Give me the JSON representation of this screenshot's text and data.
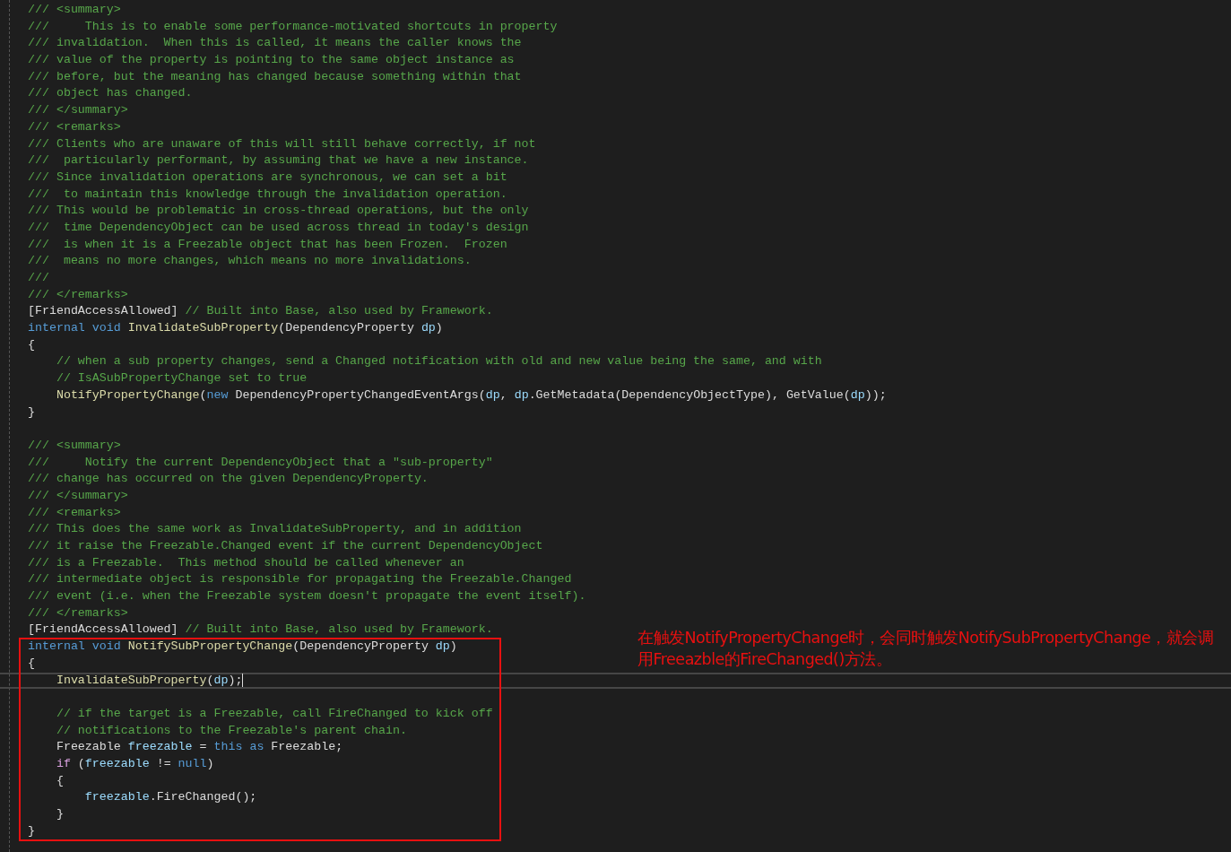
{
  "editor": {
    "blocks": [
      {
        "boxed": false,
        "lines": [
          {
            "kind": "code",
            "current": false,
            "tokens": [
              {
                "kind": "comment",
                "text": "/// <summary>"
              }
            ]
          },
          {
            "kind": "code",
            "current": false,
            "tokens": [
              {
                "kind": "comment",
                "text": "///     This is to enable some performance-motivated shortcuts in property"
              }
            ]
          },
          {
            "kind": "code",
            "current": false,
            "tokens": [
              {
                "kind": "comment",
                "text": "/// invalidation.  When this is called, it means the caller knows the"
              }
            ]
          },
          {
            "kind": "code",
            "current": false,
            "tokens": [
              {
                "kind": "comment",
                "text": "/// value of the property is pointing to the same object instance as"
              }
            ]
          },
          {
            "kind": "code",
            "current": false,
            "tokens": [
              {
                "kind": "comment",
                "text": "/// before, but the meaning has changed because something within that"
              }
            ]
          },
          {
            "kind": "code",
            "current": false,
            "tokens": [
              {
                "kind": "comment",
                "text": "/// object has changed."
              }
            ]
          },
          {
            "kind": "code",
            "current": false,
            "tokens": [
              {
                "kind": "comment",
                "text": "/// </summary>"
              }
            ]
          },
          {
            "kind": "code",
            "current": false,
            "tokens": [
              {
                "kind": "comment",
                "text": "/// <remarks>"
              }
            ]
          },
          {
            "kind": "code",
            "current": false,
            "tokens": [
              {
                "kind": "comment",
                "text": "/// Clients who are unaware of this will still behave correctly, if not"
              }
            ]
          },
          {
            "kind": "code",
            "current": false,
            "tokens": [
              {
                "kind": "comment",
                "text": "///  particularly performant, by assuming that we have a new instance."
              }
            ]
          },
          {
            "kind": "code",
            "current": false,
            "tokens": [
              {
                "kind": "comment",
                "text": "/// Since invalidation operations are synchronous, we can set a bit"
              }
            ]
          },
          {
            "kind": "code",
            "current": false,
            "tokens": [
              {
                "kind": "comment",
                "text": "///  to maintain this knowledge through the invalidation operation."
              }
            ]
          },
          {
            "kind": "code",
            "current": false,
            "tokens": [
              {
                "kind": "comment",
                "text": "/// This would be problematic in cross-thread operations, but the only"
              }
            ]
          },
          {
            "kind": "code",
            "current": false,
            "tokens": [
              {
                "kind": "comment",
                "text": "///  time DependencyObject can be used across thread in today's design"
              }
            ]
          },
          {
            "kind": "code",
            "current": false,
            "tokens": [
              {
                "kind": "comment",
                "text": "///  is when it is a Freezable object that has been Frozen.  Frozen"
              }
            ]
          },
          {
            "kind": "code",
            "current": false,
            "tokens": [
              {
                "kind": "comment",
                "text": "///  means no more changes, which means no more invalidations."
              }
            ]
          },
          {
            "kind": "code",
            "current": false,
            "tokens": [
              {
                "kind": "comment",
                "text": "///"
              }
            ]
          },
          {
            "kind": "code",
            "current": false,
            "tokens": [
              {
                "kind": "comment",
                "text": "/// </remarks>"
              }
            ]
          },
          {
            "kind": "code",
            "current": false,
            "tokens": [
              {
                "kind": "plain",
                "text": "[FriendAccessAllowed] "
              },
              {
                "kind": "comment",
                "text": "// Built into Base, also used by Framework."
              }
            ]
          },
          {
            "kind": "code",
            "current": false,
            "tokens": [
              {
                "kind": "keyword",
                "text": "internal void "
              },
              {
                "kind": "method",
                "text": "InvalidateSubProperty"
              },
              {
                "kind": "plain",
                "text": "(DependencyProperty "
              },
              {
                "kind": "variable",
                "text": "dp"
              },
              {
                "kind": "plain",
                "text": ")"
              }
            ]
          },
          {
            "kind": "code",
            "current": false,
            "tokens": [
              {
                "kind": "plain",
                "text": "{"
              }
            ]
          },
          {
            "kind": "code",
            "current": false,
            "tokens": [
              {
                "kind": "comment",
                "text": "    // when a sub property changes, send a Changed notification with old and new value being the same, and with"
              }
            ]
          },
          {
            "kind": "code",
            "current": false,
            "tokens": [
              {
                "kind": "comment",
                "text": "    // IsASubPropertyChange set to true"
              }
            ]
          },
          {
            "kind": "code",
            "current": false,
            "tokens": [
              {
                "kind": "method",
                "text": "    NotifyPropertyChange"
              },
              {
                "kind": "plain",
                "text": "("
              },
              {
                "kind": "keyword",
                "text": "new"
              },
              {
                "kind": "plain",
                "text": " DependencyPropertyChangedEventArgs("
              },
              {
                "kind": "variable",
                "text": "dp"
              },
              {
                "kind": "plain",
                "text": ", "
              },
              {
                "kind": "variable",
                "text": "dp"
              },
              {
                "kind": "plain",
                "text": ".GetMetadata(DependencyObjectType), GetValue("
              },
              {
                "kind": "variable",
                "text": "dp"
              },
              {
                "kind": "plain",
                "text": "));"
              }
            ]
          },
          {
            "kind": "code",
            "current": false,
            "tokens": [
              {
                "kind": "plain",
                "text": "}"
              }
            ]
          },
          {
            "kind": "blank",
            "current": false
          },
          {
            "kind": "code",
            "current": false,
            "tokens": [
              {
                "kind": "comment",
                "text": "/// <summary>"
              }
            ]
          },
          {
            "kind": "code",
            "current": false,
            "tokens": [
              {
                "kind": "comment",
                "text": "///     Notify the current DependencyObject that a \"sub-property\""
              }
            ]
          },
          {
            "kind": "code",
            "current": false,
            "tokens": [
              {
                "kind": "comment",
                "text": "/// change has occurred on the given DependencyProperty."
              }
            ]
          },
          {
            "kind": "code",
            "current": false,
            "tokens": [
              {
                "kind": "comment",
                "text": "/// </summary>"
              }
            ]
          },
          {
            "kind": "code",
            "current": false,
            "tokens": [
              {
                "kind": "comment",
                "text": "/// <remarks>"
              }
            ]
          },
          {
            "kind": "code",
            "current": false,
            "tokens": [
              {
                "kind": "comment",
                "text": "/// This does the same work as InvalidateSubProperty, and in addition"
              }
            ]
          },
          {
            "kind": "code",
            "current": false,
            "tokens": [
              {
                "kind": "comment",
                "text": "/// it raise the Freezable.Changed event if the current DependencyObject"
              }
            ]
          },
          {
            "kind": "code",
            "current": false,
            "tokens": [
              {
                "kind": "comment",
                "text": "/// is a Freezable.  This method should be called whenever an"
              }
            ]
          },
          {
            "kind": "code",
            "current": false,
            "tokens": [
              {
                "kind": "comment",
                "text": "/// intermediate object is responsible for propagating the Freezable.Changed"
              }
            ]
          },
          {
            "kind": "code",
            "current": false,
            "tokens": [
              {
                "kind": "comment",
                "text": "/// event (i.e. when the Freezable system doesn't propagate the event itself)."
              }
            ]
          },
          {
            "kind": "code",
            "current": false,
            "tokens": [
              {
                "kind": "comment",
                "text": "/// </remarks>"
              }
            ]
          },
          {
            "kind": "code",
            "current": false,
            "tokens": [
              {
                "kind": "plain",
                "text": "[FriendAccessAllowed] "
              },
              {
                "kind": "comment",
                "text": "// Built into Base, also used by Framework."
              }
            ]
          }
        ]
      },
      {
        "boxed": true,
        "lines": [
          {
            "kind": "code",
            "current": false,
            "tokens": [
              {
                "kind": "keyword",
                "text": "internal void "
              },
              {
                "kind": "method",
                "text": "NotifySubPropertyChange"
              },
              {
                "kind": "plain",
                "text": "(DependencyProperty "
              },
              {
                "kind": "variable",
                "text": "dp"
              },
              {
                "kind": "plain",
                "text": ")"
              }
            ]
          },
          {
            "kind": "code",
            "current": false,
            "tokens": [
              {
                "kind": "plain",
                "text": "{"
              }
            ]
          },
          {
            "kind": "code",
            "current": true,
            "tokens": [
              {
                "kind": "method",
                "text": "    InvalidateSubProperty"
              },
              {
                "kind": "plain",
                "text": "("
              },
              {
                "kind": "variable",
                "text": "dp"
              },
              {
                "kind": "plain",
                "text": ");"
              }
            ]
          },
          {
            "kind": "blank",
            "current": false
          },
          {
            "kind": "code",
            "current": false,
            "tokens": [
              {
                "kind": "comment",
                "text": "    // if the target is a Freezable, call FireChanged to kick off"
              }
            ]
          },
          {
            "kind": "code",
            "current": false,
            "tokens": [
              {
                "kind": "comment",
                "text": "    // notifications to the Freezable's parent chain."
              }
            ]
          },
          {
            "kind": "code",
            "current": false,
            "tokens": [
              {
                "kind": "plain",
                "text": "    Freezable "
              },
              {
                "kind": "variable",
                "text": "freezable"
              },
              {
                "kind": "plain",
                "text": " = "
              },
              {
                "kind": "keyword",
                "text": "this as"
              },
              {
                "kind": "plain",
                "text": " Freezable;"
              }
            ]
          },
          {
            "kind": "code",
            "current": false,
            "tokens": [
              {
                "kind": "control",
                "text": "    if"
              },
              {
                "kind": "plain",
                "text": " ("
              },
              {
                "kind": "variable",
                "text": "freezable"
              },
              {
                "kind": "plain",
                "text": " != "
              },
              {
                "kind": "keyword",
                "text": "null"
              },
              {
                "kind": "plain",
                "text": ")"
              }
            ]
          },
          {
            "kind": "code",
            "current": false,
            "tokens": [
              {
                "kind": "plain",
                "text": "    {"
              }
            ]
          },
          {
            "kind": "code",
            "current": false,
            "tokens": [
              {
                "kind": "variable",
                "text": "        freezable"
              },
              {
                "kind": "plain",
                "text": ".FireChanged();"
              }
            ]
          },
          {
            "kind": "code",
            "current": false,
            "tokens": [
              {
                "kind": "plain",
                "text": "    }"
              }
            ]
          },
          {
            "kind": "code",
            "current": false,
            "tokens": [
              {
                "kind": "plain",
                "text": "}"
              }
            ]
          }
        ]
      }
    ]
  },
  "annotation": {
    "text": "在触发NotifyPropertyChange时，会同时触发NotifySubPropertyChange，就会调用Freeazble的FireChanged()方法。"
  }
}
